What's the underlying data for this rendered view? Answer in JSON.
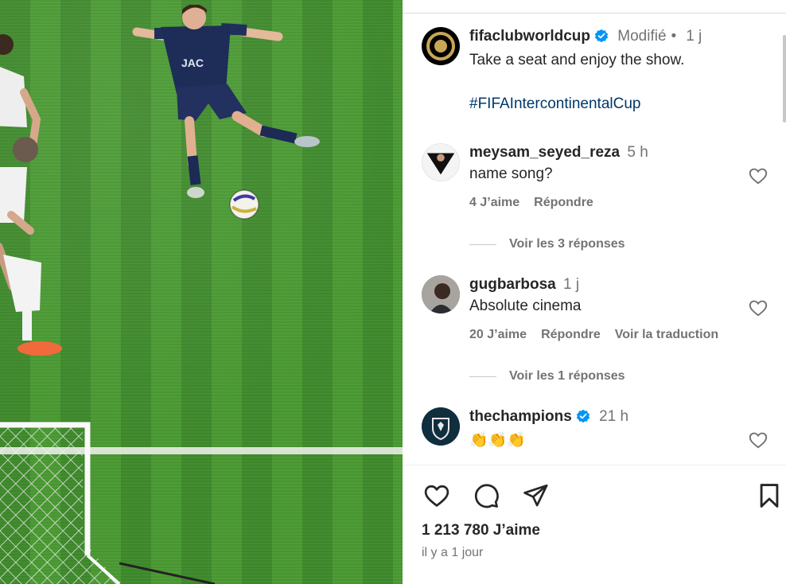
{
  "post": {
    "author": "fifaclubworldcup",
    "edited": "Modifié",
    "age": "1 j",
    "caption": "Take a seat and enjoy the show.",
    "hashtag": "#FIFAIntercontinentalCup",
    "likes": "1 213 780 J’aime",
    "date": "il y a 1 jour"
  },
  "comments": [
    {
      "username": "meysam_seyed_reza",
      "age": "5 h",
      "text": "name song?",
      "likes": "4 J’aime",
      "reply": "Répondre",
      "translate": "",
      "view_replies": "Voir les 3 réponses"
    },
    {
      "username": "gugbarbosa",
      "age": "1 j",
      "text": "Absolute cinema",
      "likes": "20 J’aime",
      "reply": "Répondre",
      "translate": "Voir la traduction",
      "view_replies": "Voir les 1 réponses"
    },
    {
      "username": "thechampions",
      "age": "21 h",
      "text": "👏👏👏",
      "verified": true
    }
  ],
  "icons": {
    "like": "heart-icon",
    "comment": "comment-icon",
    "share": "send-icon",
    "save": "bookmark-icon",
    "verified": "verified-badge-icon"
  },
  "colors": {
    "verified": "#0095f6",
    "hashtag": "#00376b",
    "muted": "#737373"
  }
}
